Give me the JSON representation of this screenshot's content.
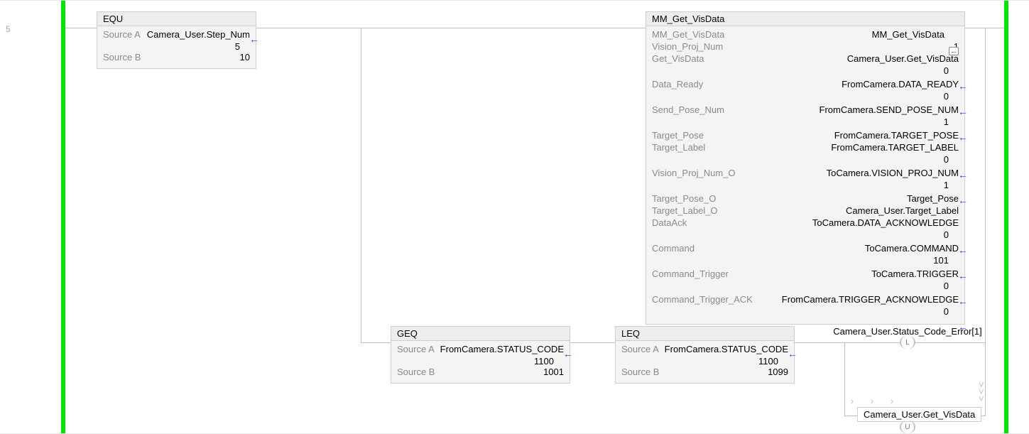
{
  "rung": "5",
  "equ": {
    "title": "EQU",
    "labelA": "Source A",
    "valueA": "Camera_User.Step_Num",
    "subA": "5",
    "labelB": "Source B",
    "valueB": "10"
  },
  "mm": {
    "title": "MM_Get_VisData",
    "rows": [
      {
        "label": "MM_Get_VisData",
        "value": "MM_Get_VisData",
        "sub": null,
        "link": true
      },
      {
        "label": "Vision_Proj_Num",
        "value": "1",
        "sub": null
      },
      {
        "label": "Get_VisData",
        "value": "Camera_User.Get_VisData",
        "sub": "0"
      },
      {
        "label": "Data_Ready",
        "value": "FromCamera.DATA_READY",
        "sub": "0"
      },
      {
        "label": "Send_Pose_Num",
        "value": "FromCamera.SEND_POSE_NUM",
        "sub": "1"
      },
      {
        "label": "Target_Pose",
        "value": "FromCamera.TARGET_POSE",
        "sub": null
      },
      {
        "label": "Target_Label",
        "value": "FromCamera.TARGET_LABEL",
        "sub": "0"
      },
      {
        "label": "Vision_Proj_Num_O",
        "value": "ToCamera.VISION_PROJ_NUM",
        "sub": "1"
      },
      {
        "label": "Target_Pose_O",
        "value": "Target_Pose",
        "sub": null
      },
      {
        "label": "Target_Label_O",
        "value": "Camera_User.Target_Label",
        "sub": null
      },
      {
        "label": "DataAck",
        "value": "ToCamera.DATA_ACKNOWLEDGE",
        "sub": "0"
      },
      {
        "label": "Command",
        "value": "ToCamera.COMMAND",
        "sub": "101"
      },
      {
        "label": "Command_Trigger",
        "value": "ToCamera.TRIGGER",
        "sub": "0"
      },
      {
        "label": "Command_Trigger_ACK",
        "value": "FromCamera.TRIGGER_ACKNOWLEDGE",
        "sub": "0"
      }
    ]
  },
  "geq": {
    "title": "GEQ",
    "labelA": "Source A",
    "valueA": "FromCamera.STATUS_CODE",
    "subA": "1100",
    "labelB": "Source B",
    "valueB": "1001"
  },
  "leq": {
    "title": "LEQ",
    "labelA": "Source A",
    "valueA": "FromCamera.STATUS_CODE",
    "subA": "1100",
    "labelB": "Source B",
    "valueB": "1099"
  },
  "coilL": {
    "mark": "L",
    "tag": "Camera_User.Status_Code_Error[1]"
  },
  "coilU": {
    "mark": "U",
    "tag": "Camera_User.Get_VisData"
  }
}
